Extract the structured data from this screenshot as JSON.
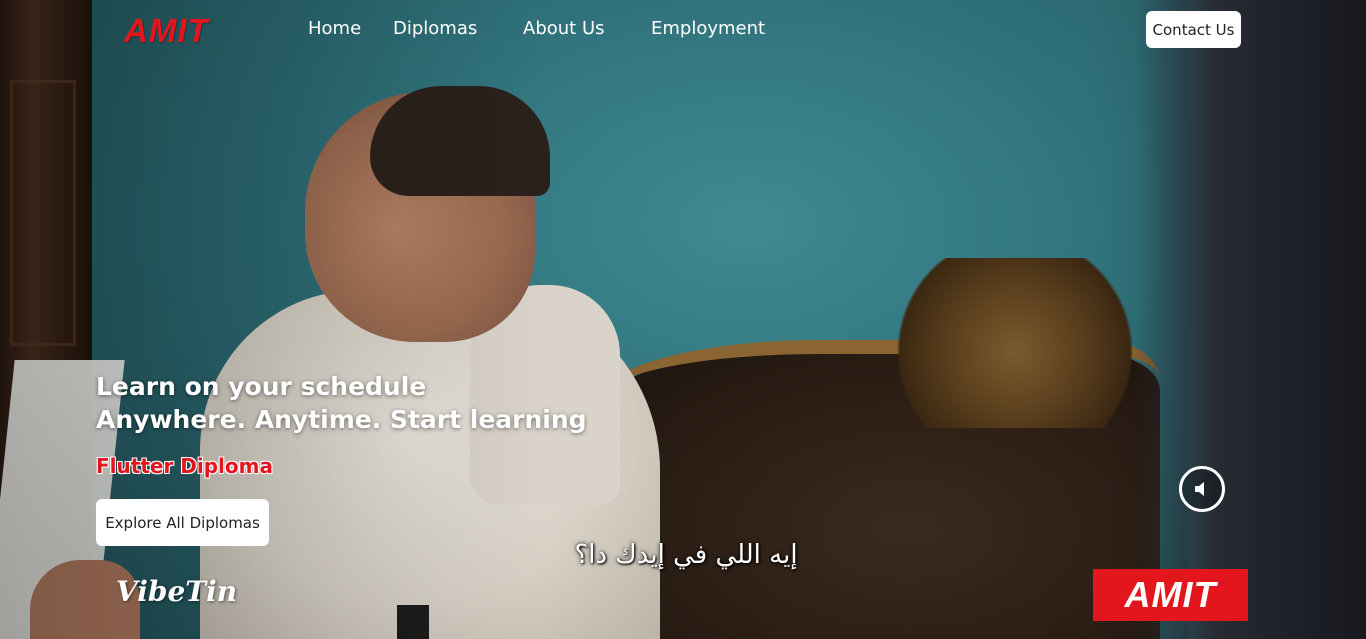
{
  "brand": {
    "logo_text": "AMIT",
    "accent_color": "#e3161d"
  },
  "nav": {
    "links": [
      {
        "label": "Home"
      },
      {
        "label": "Diplomas"
      },
      {
        "label": "About Us"
      },
      {
        "label": "Employment"
      }
    ],
    "contact_label": "Contact Us"
  },
  "hero": {
    "headline_line1": "Learn on your schedule",
    "headline_line2": "Anywhere. Anytime. Start learning",
    "diploma_name": "Flutter Diploma",
    "cta_label": "Explore All Diplomas"
  },
  "video": {
    "subtitle": "إيه اللي في إيدك دا؟",
    "sound_icon": "speaker-icon",
    "watermark_left": "VibeTin",
    "watermark_right": "AMIT"
  }
}
